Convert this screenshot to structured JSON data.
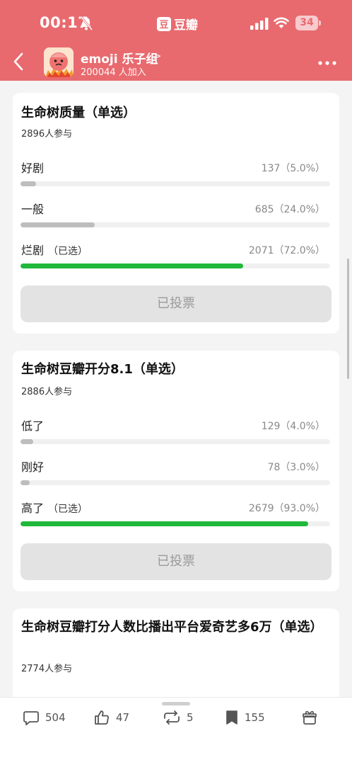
{
  "status_bar": {
    "time": "00:17",
    "app_badge": "豆",
    "app_name": "豆瓣",
    "battery": "34"
  },
  "nav": {
    "group_name": "emoji 乐子组",
    "chevron": ">",
    "members": "200044 人加入"
  },
  "polls": [
    {
      "title": "生命树质量（单选）",
      "participants": "2896人参与",
      "options": [
        {
          "label": "好剧",
          "stat": "137（5.0%）",
          "percent": 5.0,
          "selected": false,
          "selected_text": ""
        },
        {
          "label": "一般",
          "stat": "685（24.0%）",
          "percent": 24.0,
          "selected": false,
          "selected_text": ""
        },
        {
          "label": "烂剧",
          "stat": "2071（72.0%）",
          "percent": 72.0,
          "selected": true,
          "selected_text": "（已选）"
        }
      ],
      "button": "已投票"
    },
    {
      "title": "生命树豆瓣开分8.1（单选）",
      "participants": "2886人参与",
      "options": [
        {
          "label": "低了",
          "stat": "129（4.0%）",
          "percent": 4.0,
          "selected": false,
          "selected_text": ""
        },
        {
          "label": "刚好",
          "stat": "78（3.0%）",
          "percent": 3.0,
          "selected": false,
          "selected_text": ""
        },
        {
          "label": "高了",
          "stat": "2679（93.0%）",
          "percent": 93.0,
          "selected": true,
          "selected_text": "（已选）"
        }
      ],
      "button": "已投票"
    },
    {
      "title": "生命树豆瓣打分人数比播出平台爱奇艺多6万（单选）",
      "participants": "2774人参与"
    }
  ],
  "bottom_bar": {
    "comments": "504",
    "likes": "47",
    "reshares": "5",
    "collects": "155",
    "icons": [
      "comment-icon",
      "thumbs-up-icon",
      "repost-icon",
      "bookmark-icon",
      "gift-icon"
    ]
  },
  "colors": {
    "header": "#e86a6f",
    "selected_bar": "#1fb83a",
    "unselected_bar": "#bdbdbd"
  }
}
